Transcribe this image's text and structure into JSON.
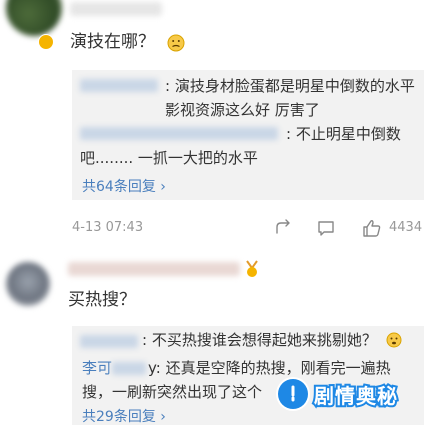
{
  "comment1": {
    "text": "演技在哪？",
    "replies": [
      {
        "username": "",
        "text": ": 演技身材脸蛋都是明星中倒数的水平 影视资源这么好 厉害了"
      },
      {
        "username": "",
        "text": ": 不止明星中倒数吧........ 一抓一大把的水平"
      }
    ],
    "replies_link": "共64条回复 ›",
    "time": "4-13 07:43",
    "likes": "4434"
  },
  "comment2": {
    "text": "买热搜？",
    "replies": [
      {
        "username": "",
        "text": ": 不买热搜谁会想得起她来挑剔她？"
      },
      {
        "username": "李可",
        "text": "y: 还真是空降的热搜，刚看完一遍热搜，一刷新突然出现了这个"
      }
    ],
    "replies_link": "共29条回复 ›"
  },
  "watermark": {
    "text": "剧情奥秘"
  },
  "colors": {
    "link": "#4a7fbd",
    "reply_bg": "#f2f2f2",
    "watermark_blue": "#1e88e5"
  }
}
